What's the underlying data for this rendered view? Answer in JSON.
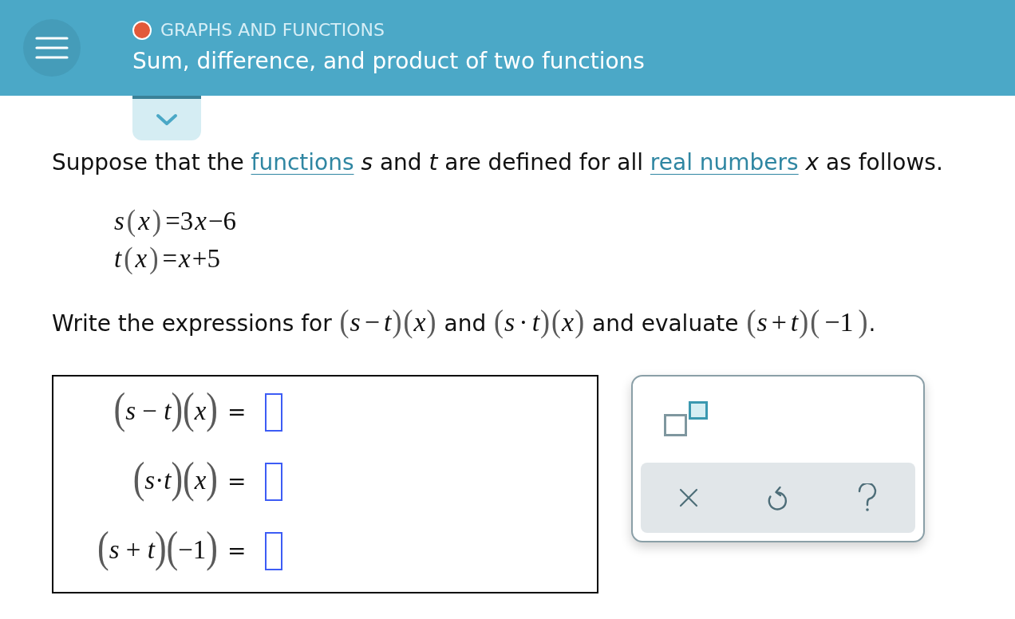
{
  "header": {
    "topic": {
      "label": "GRAPHS AND FUNCTIONS",
      "color": "#e2593a"
    },
    "title": "Sum, difference, and product of two functions"
  },
  "details_toggle": {
    "expanded": false
  },
  "problem": {
    "intro": [
      {
        "kind": "text",
        "text": "Suppose that the "
      },
      {
        "kind": "link",
        "text": "functions"
      },
      {
        "kind": "text",
        "text": " *s* and *t* are defined for all "
      },
      {
        "kind": "link",
        "text": "real numbers"
      },
      {
        "kind": "text",
        "text": " *x* as follows."
      }
    ],
    "definitions": [
      [
        {
          "kind": "var",
          "text": "s"
        },
        {
          "kind": "paren",
          "text": "("
        },
        {
          "kind": "var",
          "text": "x"
        },
        {
          "kind": "paren",
          "text": ")"
        },
        {
          "kind": "sym",
          "text": "=3"
        },
        {
          "kind": "var",
          "text": "x"
        },
        {
          "kind": "sym",
          "text": "−6"
        }
      ],
      [
        {
          "kind": "var",
          "text": "t"
        },
        {
          "kind": "paren",
          "text": "("
        },
        {
          "kind": "var",
          "text": "x"
        },
        {
          "kind": "paren",
          "text": ")"
        },
        {
          "kind": "sym",
          "text": "="
        },
        {
          "kind": "var",
          "text": "x"
        },
        {
          "kind": "sym",
          "text": "+5"
        }
      ]
    ],
    "instruction": [
      {
        "kind": "text",
        "text": "Write the expressions for "
      },
      {
        "kind": "paren",
        "text": "("
      },
      {
        "kind": "var",
        "text": "s"
      },
      {
        "kind": "sym",
        "text": "−"
      },
      {
        "kind": "var",
        "text": "t"
      },
      {
        "kind": "paren",
        "text": ")"
      },
      {
        "kind": "paren",
        "text": "("
      },
      {
        "kind": "var",
        "text": "x"
      },
      {
        "kind": "paren",
        "text": ")"
      },
      {
        "kind": "text",
        "text": " and "
      },
      {
        "kind": "paren",
        "text": "("
      },
      {
        "kind": "var",
        "text": "s"
      },
      {
        "kind": "sym",
        "text": "·"
      },
      {
        "kind": "var",
        "text": "t"
      },
      {
        "kind": "paren",
        "text": ")"
      },
      {
        "kind": "paren",
        "text": "("
      },
      {
        "kind": "var",
        "text": "x"
      },
      {
        "kind": "paren",
        "text": ")"
      },
      {
        "kind": "text",
        "text": " and evaluate "
      },
      {
        "kind": "paren",
        "text": "("
      },
      {
        "kind": "var",
        "text": "s"
      },
      {
        "kind": "sym",
        "text": "+"
      },
      {
        "kind": "var",
        "text": "t"
      },
      {
        "kind": "paren",
        "text": ")"
      },
      {
        "kind": "paren",
        "text": "("
      },
      {
        "kind": "sym",
        "text": "−1"
      },
      {
        "kind": "paren",
        "text": ")"
      },
      {
        "kind": "text",
        "text": "."
      }
    ]
  },
  "answers": [
    {
      "expression": [
        {
          "kind": "paren",
          "text": "("
        },
        {
          "kind": "var",
          "text": "s"
        },
        {
          "kind": "sym",
          "text": " − "
        },
        {
          "kind": "var",
          "text": "t"
        },
        {
          "kind": "paren",
          "text": ")"
        },
        {
          "kind": "paren",
          "text": "("
        },
        {
          "kind": "var",
          "text": "x"
        },
        {
          "kind": "paren",
          "text": ")"
        }
      ],
      "sign": "="
    },
    {
      "expression": [
        {
          "kind": "paren",
          "text": "("
        },
        {
          "kind": "var",
          "text": "s"
        },
        {
          "kind": "sym",
          "text": "·"
        },
        {
          "kind": "var",
          "text": "t"
        },
        {
          "kind": "paren",
          "text": ")"
        },
        {
          "kind": "paren",
          "text": "("
        },
        {
          "kind": "var",
          "text": "x"
        },
        {
          "kind": "paren",
          "text": ")"
        }
      ],
      "sign": "="
    },
    {
      "expression": [
        {
          "kind": "paren",
          "text": "("
        },
        {
          "kind": "var",
          "text": "s"
        },
        {
          "kind": "sym",
          "text": " + "
        },
        {
          "kind": "var",
          "text": "t"
        },
        {
          "kind": "paren",
          "text": ")"
        },
        {
          "kind": "paren",
          "text": "("
        },
        {
          "kind": "sym",
          "text": "−1"
        },
        {
          "kind": "paren",
          "text": ")"
        }
      ],
      "sign": "="
    }
  ],
  "keypad": {
    "templates": [
      {
        "kind": "superscript"
      }
    ],
    "actions": [
      {
        "kind": "clear"
      },
      {
        "kind": "undo"
      },
      {
        "kind": "help"
      }
    ]
  }
}
